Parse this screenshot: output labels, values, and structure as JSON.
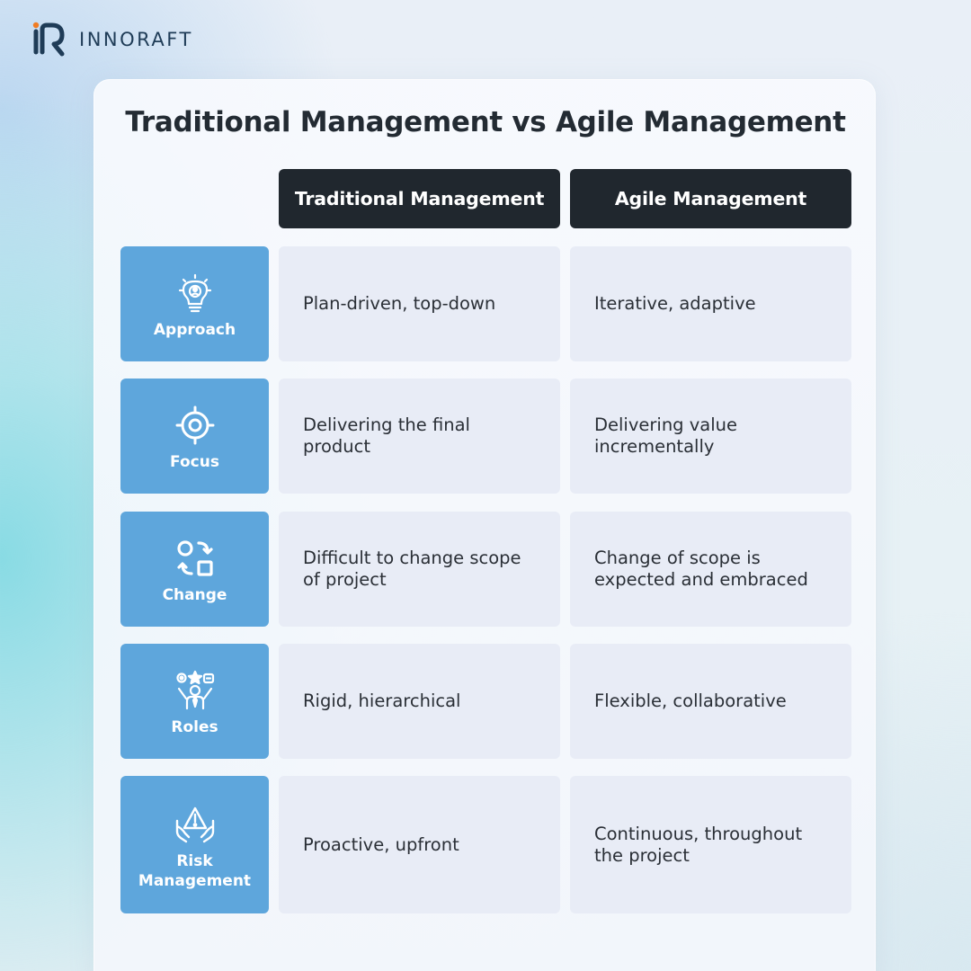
{
  "brand": {
    "name": "INNORAFT",
    "accent_color": "#f07c23",
    "logo_color": "#1f3c57"
  },
  "title": "Traditional Management vs Agile Management",
  "columns": {
    "traditional": "Traditional Management",
    "agile": "Agile Management"
  },
  "rows": [
    {
      "label": "Approach",
      "icon": "lightbulb-gear-icon",
      "traditional": "Plan-driven, top-down",
      "agile": "Iterative, adaptive"
    },
    {
      "label": "Focus",
      "icon": "target-icon",
      "traditional": "Delivering the final product",
      "agile": "Delivering value incrementally"
    },
    {
      "label": "Change",
      "icon": "shapes-swap-icon",
      "traditional": "Difficult to change scope of project",
      "agile": "Change of scope is expected and embraced"
    },
    {
      "label": "Roles",
      "icon": "person-roles-icon",
      "traditional": "Rigid, hierarchical",
      "agile": "Flexible, collaborative"
    },
    {
      "label": "Risk\nManagement",
      "icon": "hands-warning-icon",
      "traditional": "Proactive, upfront",
      "agile": "Continuous, throughout the project"
    }
  ],
  "colors": {
    "header_bg": "#20272e",
    "label_bg": "#5ea6dc",
    "cell_bg": "#e8ecf6",
    "title_text": "#232b33"
  }
}
